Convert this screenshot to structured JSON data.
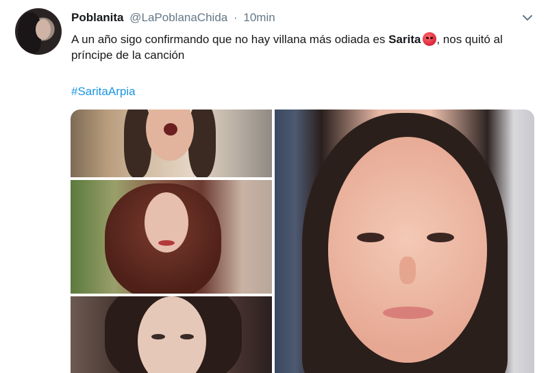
{
  "tweet": {
    "display_name": "Poblanita",
    "handle": "@LaPoblanaChida",
    "separator": "·",
    "time": "10min",
    "text_part1": "A un año sigo confirmando que no hay villana más odiada es ",
    "text_bold": "Sarita",
    "text_part2": ", nos quitó al príncipe de la canción",
    "hashtag": "#SaritaArpia",
    "emoji": "angry-face-emoji"
  },
  "colors": {
    "text": "#14171a",
    "secondary": "#657786",
    "link": "#1b95e0",
    "background": "#ffffff"
  },
  "icons": {
    "menu": "chevron-down-icon"
  }
}
